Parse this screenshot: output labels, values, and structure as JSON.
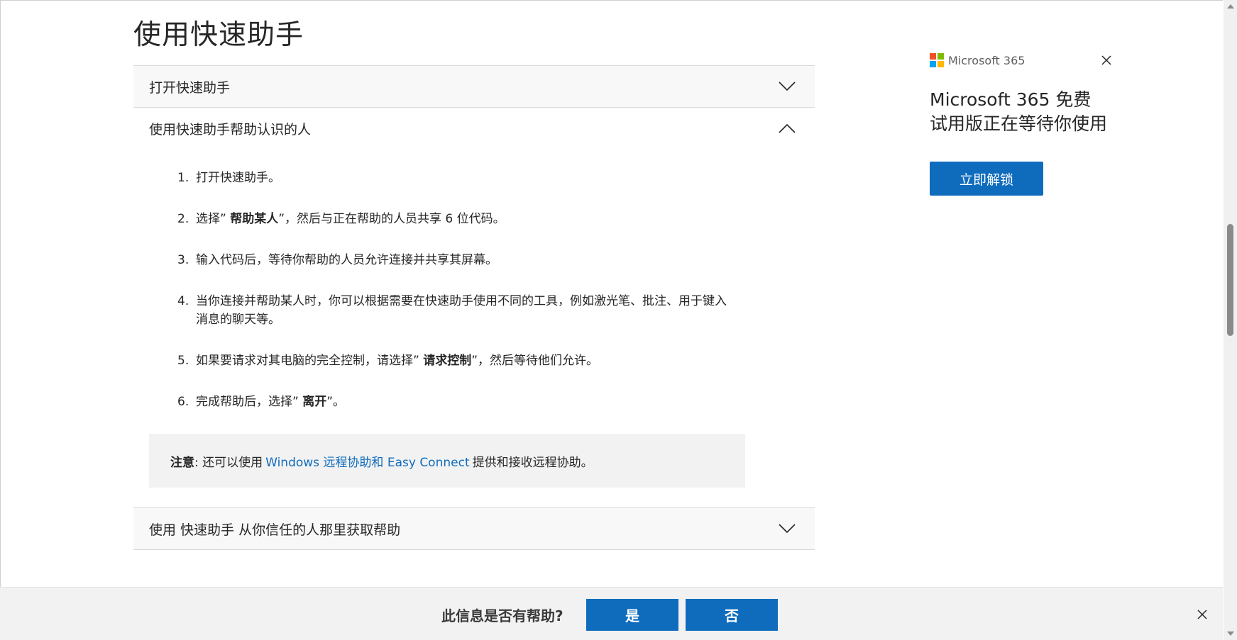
{
  "page": {
    "title": "使用快速助手"
  },
  "accordion": {
    "items": [
      {
        "label": "打开快速助手",
        "expanded": false
      },
      {
        "label": "使用快速助手帮助认识的人",
        "expanded": true
      },
      {
        "label": "使用 快速助手 从你信任的人那里获取帮助",
        "expanded": false
      }
    ],
    "steps": [
      {
        "num": "1.",
        "pre": "打开快速助手。",
        "bold": "",
        "post": ""
      },
      {
        "num": "2.",
        "pre": "选择” ",
        "bold": "帮助某人",
        "post": "”，然后与正在帮助的人员共享 6 位代码。"
      },
      {
        "num": "3.",
        "pre": "输入代码后，等待你帮助的人员允许连接并共享其屏幕。",
        "bold": "",
        "post": ""
      },
      {
        "num": "4.",
        "pre": "当你连接并帮助某人时，你可以根据需要在快速助手使用不同的工具，例如激光笔、批注、用于键入消息的聊天等。",
        "bold": "",
        "post": ""
      },
      {
        "num": "5.",
        "pre": "如果要请求对其电脑的完全控制，请选择” ",
        "bold": "请求控制",
        "post": "”，然后等待他们允许。"
      },
      {
        "num": "6.",
        "pre": "完成帮助后，选择” ",
        "bold": "离开",
        "post": "”。"
      }
    ],
    "note": {
      "label": "注意",
      "pre": ": 还可以使用",
      "link": "Windows 远程协助和 Easy Connect",
      "post": "提供和接收远程协助。"
    }
  },
  "promo": {
    "brand": "Microsoft 365",
    "text": "Microsoft 365 免费试用版正在等待你使用",
    "button": "立即解锁",
    "logo_colors": [
      "#f25022",
      "#7fba00",
      "#00a4ef",
      "#ffb900"
    ]
  },
  "feedback": {
    "question": "此信息是否有帮助?",
    "yes": "是",
    "no": "否"
  },
  "icons": {
    "chevron_down": "chevron-down-icon",
    "chevron_up": "chevron-up-icon",
    "close": "close-icon"
  },
  "colors": {
    "accent": "#0f6cbd",
    "header_bg": "#f8f8f8",
    "note_bg": "#f2f2f2"
  }
}
